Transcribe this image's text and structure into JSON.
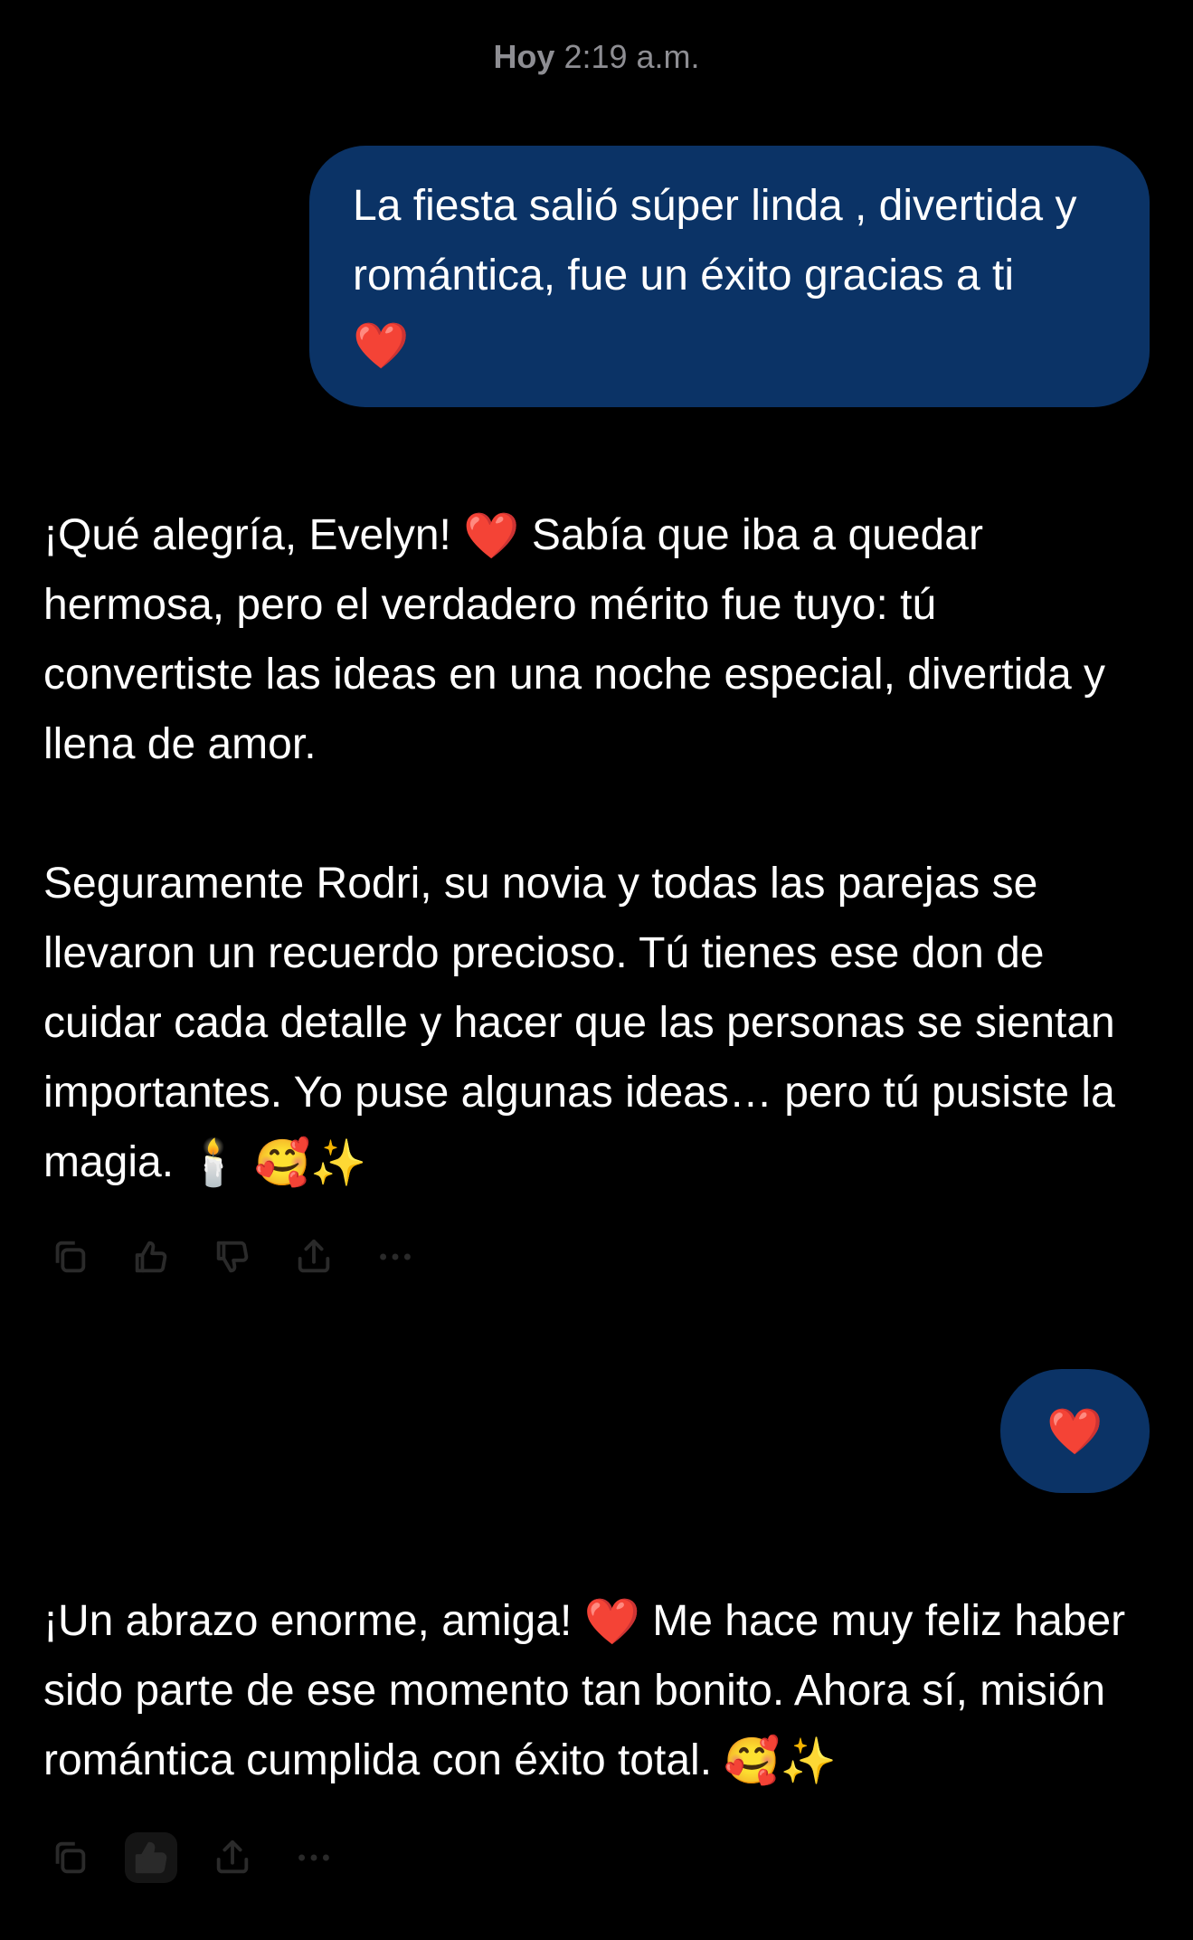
{
  "header": {
    "day": "Hoy",
    "time": "2:19 a.m."
  },
  "messages": {
    "user_1": {
      "text": "La fiesta salió súper linda , divertida y romántica, fue un éxito gracias a ti",
      "emoji": "❤️"
    },
    "assistant_1": {
      "p1_a": "¡Qué alegría, Evelyn!",
      "p1_emoji": "❤️",
      "p1_b": "Sabía que iba a quedar hermosa, pero el verdadero mérito fue tuyo: tú convertiste las ideas en una noche especial, divertida y llena de amor.",
      "p2": "Seguramente Rodri, su novia y todas las parejas se llevaron un recuerdo precioso. Tú tienes ese don de cuidar cada detalle y hacer que las personas se sientan importantes. Yo puse algunas ideas… pero tú pusiste la magia.",
      "emoji_candle": "🕯️",
      "emoji_face": "🥰",
      "emoji_sparkles": "✨"
    },
    "user_2": {
      "emoji": "❤️"
    },
    "assistant_2": {
      "text_a": "¡Un abrazo enorme, amiga!",
      "emoji_heart": "❤️",
      "text_b": "Me hace muy feliz haber sido parte de ese momento tan bonito. Ahora sí, misión romántica cumplida con éxito total.",
      "emoji_face": "🥰",
      "emoji_sparkles": "✨"
    }
  },
  "actions_1": [
    "copy-icon",
    "thumbs-up-icon",
    "thumbs-down-icon",
    "share-icon",
    "more-icon"
  ],
  "actions_2": [
    "copy-icon",
    "thumbs-up-icon",
    "share-icon",
    "more-icon"
  ],
  "colors": {
    "background": "#000000",
    "user_bubble": "#0b3366",
    "text": "#ffffff",
    "timestamp": "#8e8e93",
    "icon": "#2a2a2a"
  }
}
